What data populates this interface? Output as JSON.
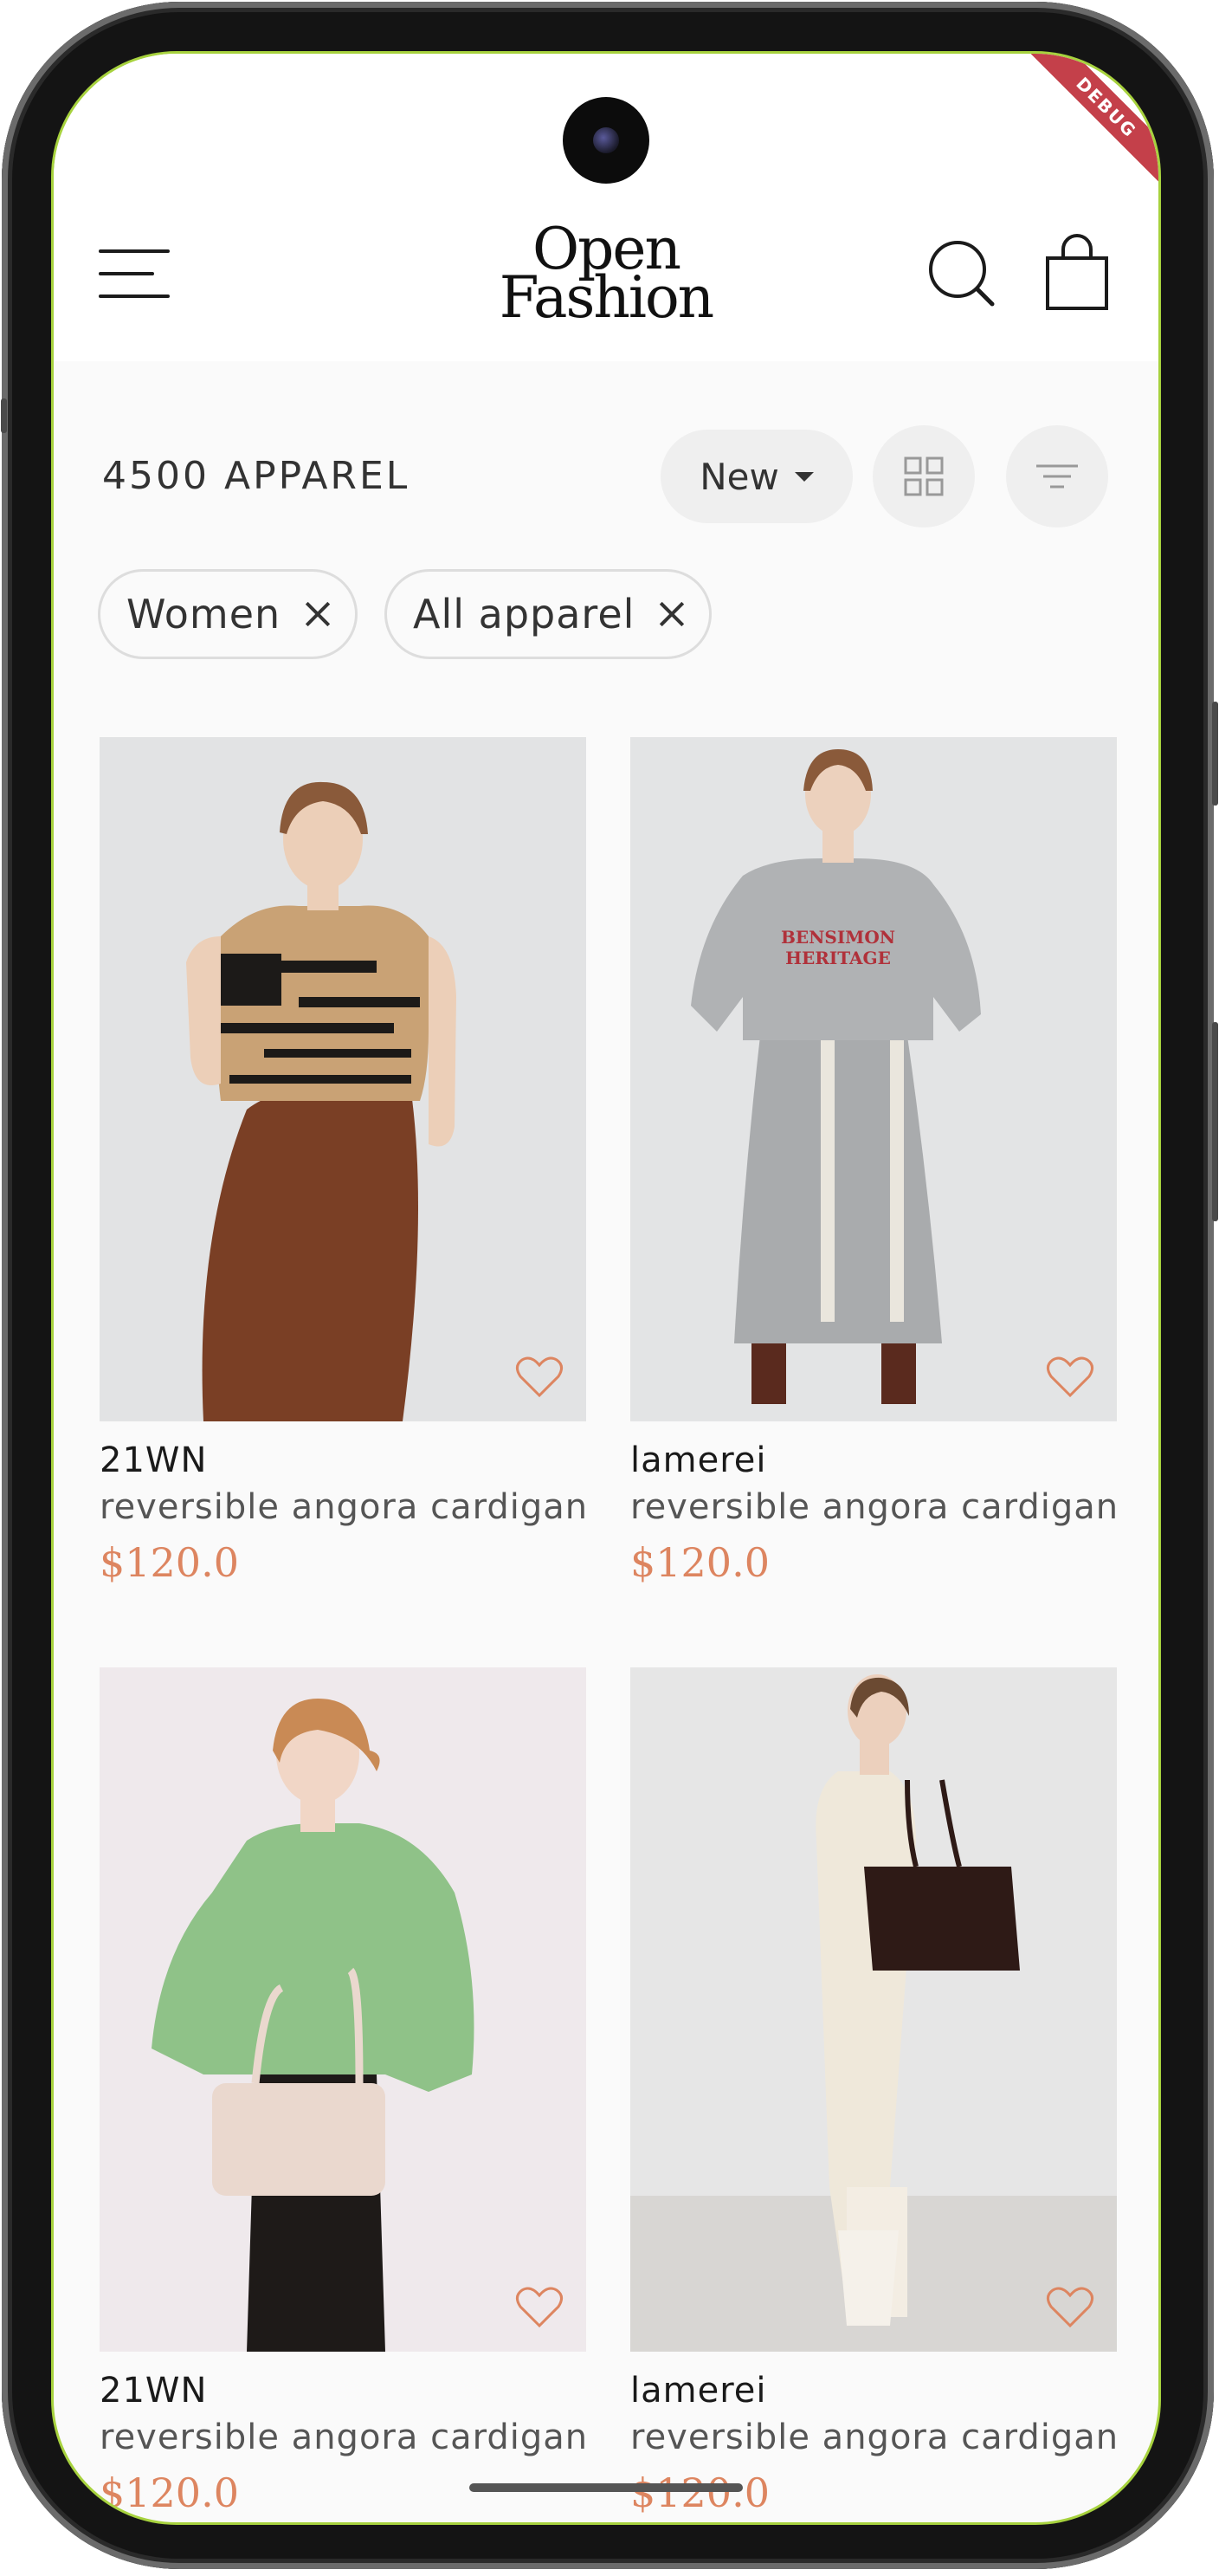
{
  "debug_banner": "DEBUG",
  "header": {
    "logo_line1": "Open",
    "logo_line2": "Fashion",
    "icons": [
      "menu-icon",
      "search-icon",
      "shopping-bag-icon"
    ]
  },
  "toolbar": {
    "result_count": "4500 APPAREL",
    "sort_label": "New",
    "icons": [
      "grid-view-icon",
      "filter-icon"
    ]
  },
  "filters": [
    {
      "label": "Women"
    },
    {
      "label": "All apparel"
    }
  ],
  "products": [
    {
      "brand": "21WN",
      "name": "reversible angora cardigan",
      "price": "$120.0"
    },
    {
      "brand": "lamerei",
      "name": "reversible angora cardigan",
      "price": "$120.0"
    },
    {
      "brand": "21WN",
      "name": "reversible angora cardigan",
      "price": "$120.0"
    },
    {
      "brand": "lamerei",
      "name": "reversible angora cardigan",
      "price": "$120.0"
    }
  ],
  "colors": {
    "accent_price": "#dd8560",
    "background": "#fafafa",
    "chip_border": "#dddddd",
    "debug_ribbon": "#c4404a"
  }
}
